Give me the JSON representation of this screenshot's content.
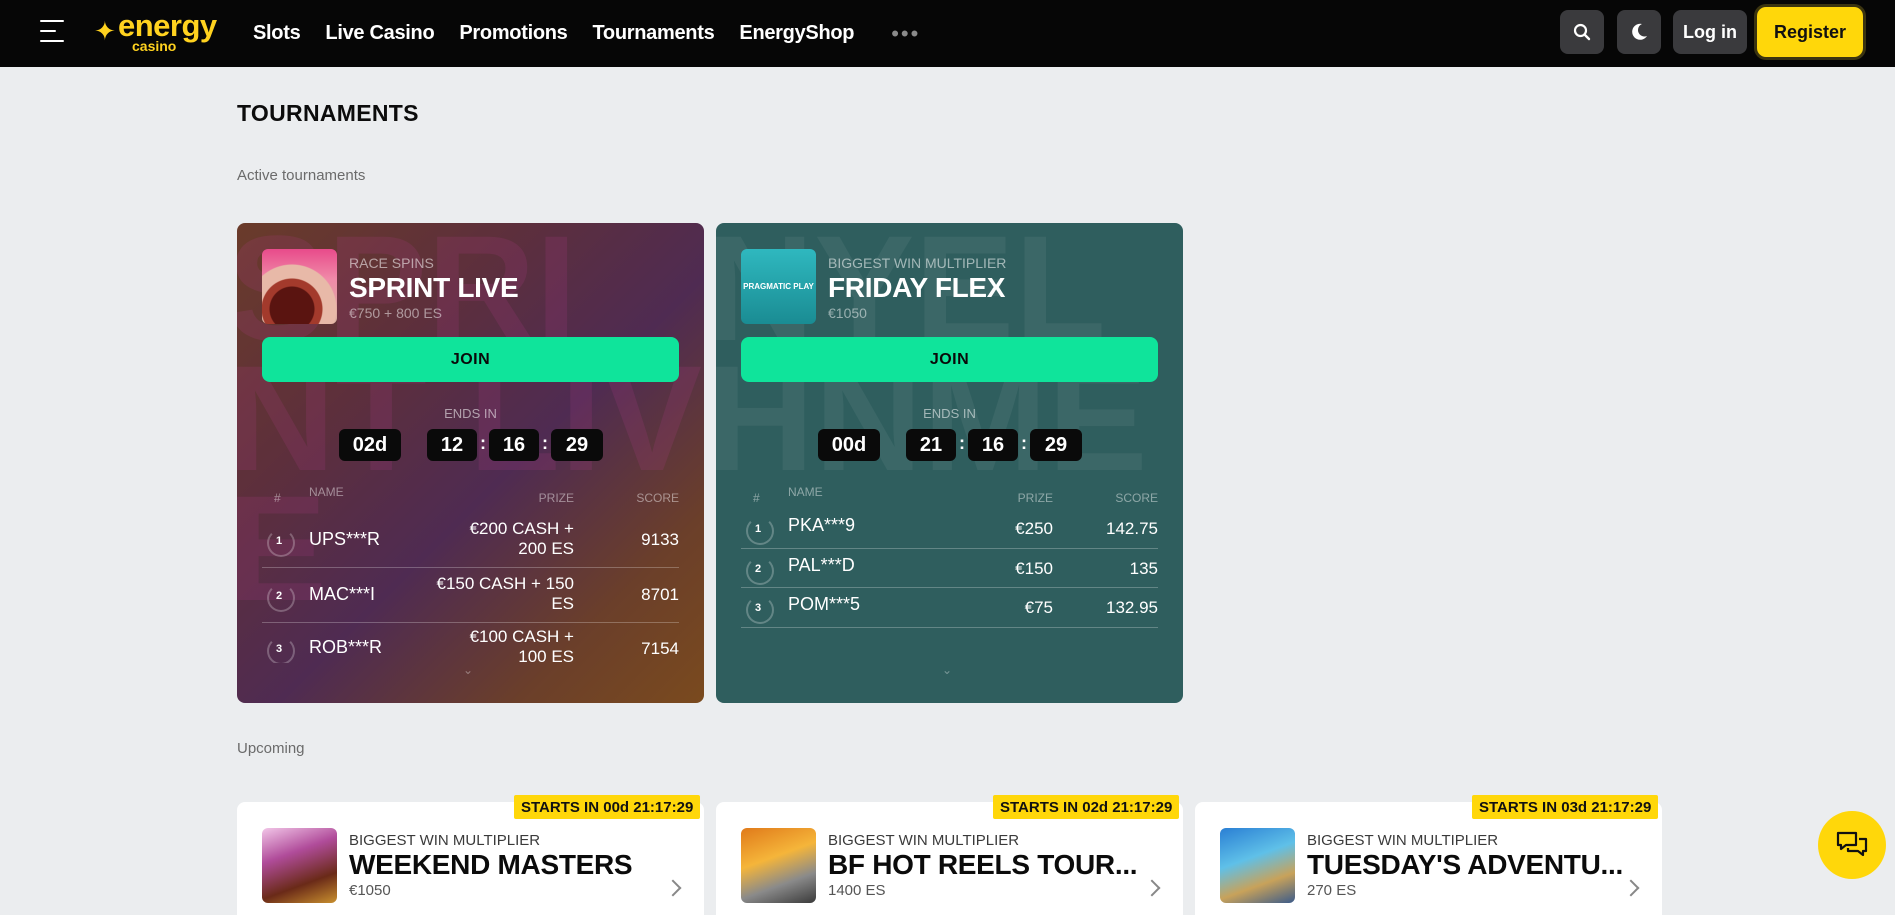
{
  "header": {
    "logo_word": "energy",
    "logo_sub": "casino",
    "nav": [
      "Slots",
      "Live Casino",
      "Promotions",
      "Tournaments",
      "EnergyShop"
    ],
    "more": "•••",
    "login_label": "Log in",
    "register_label": "Register"
  },
  "page": {
    "title": "TOURNAMENTS",
    "active_label": "Active tournaments",
    "upcoming_label": "Upcoming"
  },
  "active": [
    {
      "type": "RACE SPINS",
      "name": "SPRINT LIVE",
      "prize": "€750 + 800 ES",
      "join": "JOIN",
      "ends_label": "ENDS IN",
      "timer": {
        "days": "02d",
        "hours": "12",
        "minutes": "16",
        "seconds": "29"
      },
      "headers": {
        "num": "#",
        "name": "NAME",
        "prize": "PRIZE",
        "score": "SCORE"
      },
      "rows": [
        {
          "rank": "1",
          "name": "UPS***R",
          "prize_line1": "€200 CASH +",
          "prize_line2": "200 ES",
          "score": "9133"
        },
        {
          "rank": "2",
          "name": "MAC***I",
          "prize_line1": "€150 CASH + 150",
          "prize_line2": "ES",
          "score": "8701"
        },
        {
          "rank": "3",
          "name": "ROB***R",
          "prize_line1": "€100 CASH +",
          "prize_line2": "100 ES",
          "score": "7154"
        }
      ]
    },
    {
      "type": "BIGGEST WIN MULTIPLIER",
      "name": "FRIDAY FLEX",
      "prize": "€1050",
      "join": "JOIN",
      "ends_label": "ENDS IN",
      "timer": {
        "days": "00d",
        "hours": "21",
        "minutes": "16",
        "seconds": "29"
      },
      "headers": {
        "num": "#",
        "name": "NAME",
        "prize": "PRIZE",
        "score": "SCORE"
      },
      "rows": [
        {
          "rank": "1",
          "name": "PKA***9",
          "prize": "€250",
          "score": "142.75"
        },
        {
          "rank": "2",
          "name": "PAL***D",
          "prize": "€150",
          "score": "135"
        },
        {
          "rank": "3",
          "name": "POM***5",
          "prize": "€75",
          "score": "132.95"
        }
      ]
    }
  ],
  "upcoming": [
    {
      "badge": "STARTS IN 00d 21:17:29",
      "type": "BIGGEST WIN MULTIPLIER",
      "name": "WEEKEND MASTERS",
      "prize": "€1050"
    },
    {
      "badge": "STARTS IN 02d 21:17:29",
      "type": "BIGGEST WIN MULTIPLIER",
      "name": "BF HOT REELS TOUR...",
      "prize": "1400 ES"
    },
    {
      "badge": "STARTS IN 03d 21:17:29",
      "type": "BIGGEST WIN MULTIPLIER",
      "name": "TUESDAY'S ADVENTU...",
      "prize": "270 ES"
    }
  ],
  "colors": {
    "accent_yellow": "#ffd70a",
    "join_green": "#0fe49b",
    "topbar": "#060606"
  }
}
